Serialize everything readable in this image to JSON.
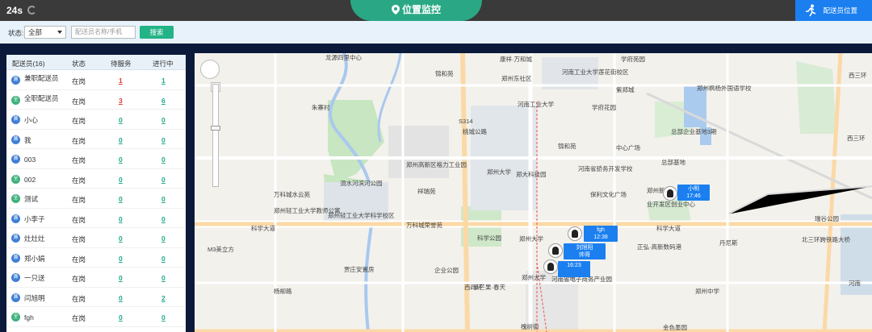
{
  "header": {
    "timer": "24s",
    "title": "位置监控",
    "courier_location_button": "配送员位置"
  },
  "filter": {
    "status_label": "状态:",
    "status_value": "全部",
    "search_placeholder": "配送员名称/手机",
    "search_button": "搜索"
  },
  "table": {
    "headers": {
      "name": "配送员(16)",
      "status": "状态",
      "pending": "待服务",
      "in_progress": "进行中"
    },
    "rows": [
      {
        "badge": "兼",
        "badge_color": "blue",
        "name": "兼职配送员",
        "status": "在岗",
        "pending": "1",
        "pending_color": "red",
        "in_progress": "1"
      },
      {
        "badge": "全",
        "badge_color": "green",
        "name": "全职配送员",
        "status": "在岗",
        "pending": "3",
        "pending_color": "red",
        "in_progress": "6"
      },
      {
        "badge": "兼",
        "badge_color": "blue",
        "name": "小心",
        "status": "在岗",
        "pending": "0",
        "pending_color": "teal",
        "in_progress": "0"
      },
      {
        "badge": "兼",
        "badge_color": "blue",
        "name": "我",
        "status": "在岗",
        "pending": "0",
        "pending_color": "teal",
        "in_progress": "0"
      },
      {
        "badge": "兼",
        "badge_color": "blue",
        "name": "003",
        "status": "在岗",
        "pending": "0",
        "pending_color": "teal",
        "in_progress": "0"
      },
      {
        "badge": "全",
        "badge_color": "green",
        "name": "002",
        "status": "在岗",
        "pending": "0",
        "pending_color": "teal",
        "in_progress": "0"
      },
      {
        "badge": "全",
        "badge_color": "green",
        "name": "测试",
        "status": "在岗",
        "pending": "0",
        "pending_color": "teal",
        "in_progress": "0"
      },
      {
        "badge": "兼",
        "badge_color": "blue",
        "name": "小李子",
        "status": "在岗",
        "pending": "0",
        "pending_color": "teal",
        "in_progress": "0"
      },
      {
        "badge": "兼",
        "badge_color": "blue",
        "name": "灶灶灶",
        "status": "在岗",
        "pending": "0",
        "pending_color": "teal",
        "in_progress": "0"
      },
      {
        "badge": "兼",
        "badge_color": "blue",
        "name": "郑小娟",
        "status": "在岗",
        "pending": "0",
        "pending_color": "teal",
        "in_progress": "0"
      },
      {
        "badge": "兼",
        "badge_color": "blue",
        "name": "一只送",
        "status": "在岗",
        "pending": "0",
        "pending_color": "teal",
        "in_progress": "0"
      },
      {
        "badge": "兼",
        "badge_color": "blue",
        "name": "闫旭明",
        "status": "在岗",
        "pending": "0",
        "pending_color": "teal",
        "in_progress": "2"
      },
      {
        "badge": "全",
        "badge_color": "green",
        "name": "fgh",
        "status": "在岗",
        "pending": "0",
        "pending_color": "teal",
        "in_progress": "0"
      }
    ]
  },
  "map": {
    "labels": [
      "龙源四里中心",
      "锦和苑",
      "康祥·万和城",
      "学府苑园",
      "郑州东社区",
      "河南工业大学莲花街校区",
      "紫郑城",
      "郑州枫杨外国语学校",
      "朱寨村",
      "S314",
      "河南工业大学",
      "学府花园",
      "桃城公路",
      "中心广场",
      "总部企业基地3期",
      "西三环",
      "郑州高新区格力工业园",
      "郑州大学",
      "郑大科技园",
      "锦和苑",
      "河南省骄务开发学校",
      "总部基地",
      "須水河滨河公园",
      "祥瑞苑",
      "万科城水云苑",
      "保利文化广场",
      "郑州新",
      "业开发区创业中心",
      "郑州轻工业大学教师公寓",
      "郑州轻工业大学科学校区",
      "万科城荣誉苑",
      "科学公园",
      "郑州大学",
      "科学大道",
      "丹尼斯",
      "北三环跨铁路大桥",
      "M3美立方",
      "贾庄安置房",
      "企业公园",
      "郑州大学",
      "正弘·高新数码港",
      "郑州中学",
      "西四环",
      "新芒果·春天",
      "河南省电子商务产业园",
      "金色墨园",
      "槐树街",
      "河南",
      "杨柳路",
      "科学大道",
      "瑞谷公园",
      "西三环"
    ],
    "markers": [
      {
        "name": "小明",
        "time": "17:46"
      },
      {
        "name": "fgh",
        "time": "12:38"
      },
      {
        "name": "刘旭阳",
        "time": "帅哥"
      },
      {
        "name": "",
        "time": "16:23"
      }
    ]
  },
  "colors": {
    "accent": "#2aa885",
    "blue": "#1b7ff0",
    "red": "#e03a3a",
    "teal": "#20a88a"
  }
}
